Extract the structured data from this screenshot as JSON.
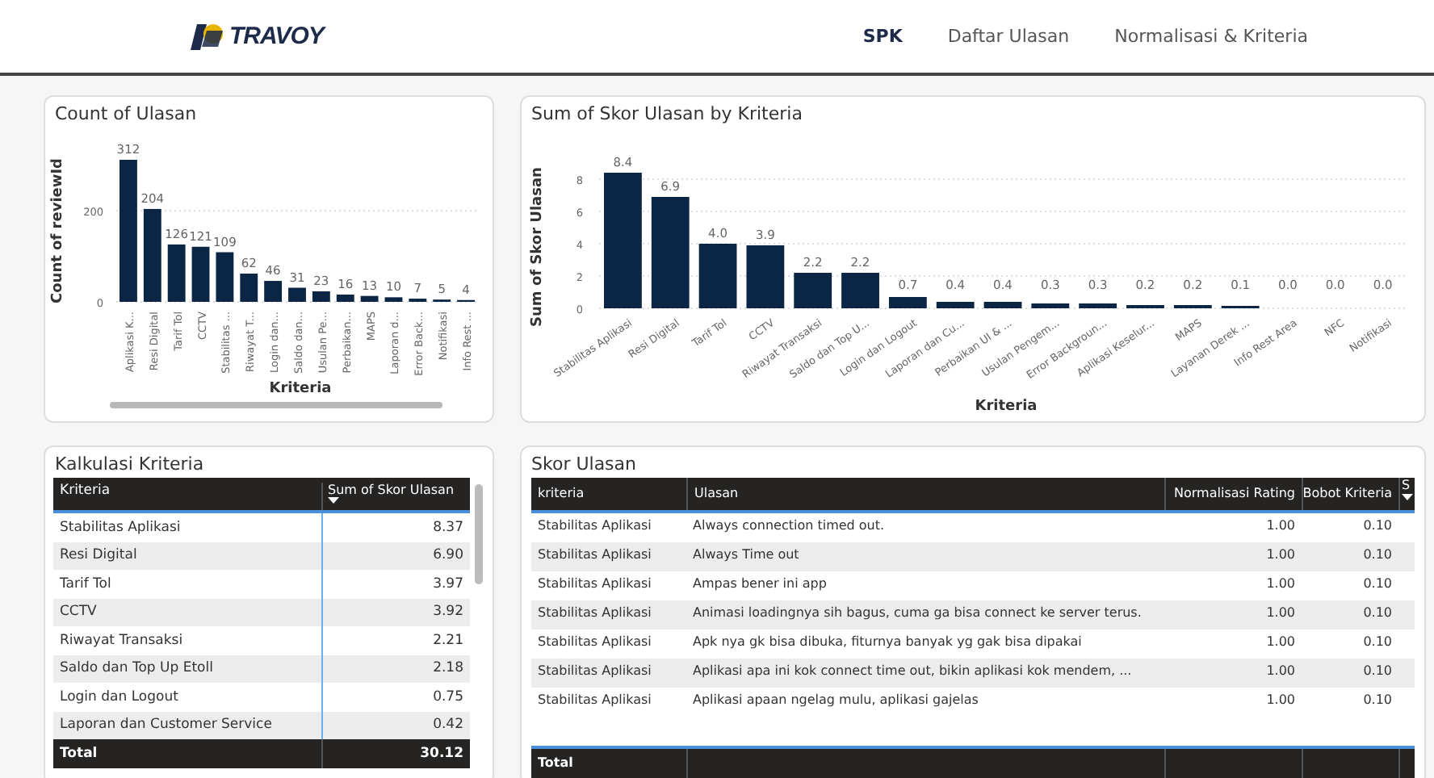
{
  "header": {
    "logo_text": "TRAVOY",
    "nav": [
      {
        "label": "SPK",
        "selected": true
      },
      {
        "label": "Daftar Ulasan",
        "selected": false
      },
      {
        "label": "Normalisasi & Kriteria",
        "selected": false
      }
    ]
  },
  "count_card": {
    "title": "Count of Ulasan",
    "chart_data": {
      "type": "bar",
      "xlabel": "Kriteria",
      "ylabel": "Count of reviewId",
      "categories": [
        "Aplikasi K...",
        "Resi Digital",
        "Tarif Tol",
        "CCTV",
        "Stabilitas ...",
        "Riwayat T...",
        "Login dan...",
        "Saldo dan...",
        "Usulan Pe...",
        "Perbaikan...",
        "MAPS",
        "Laporan d...",
        "Error Back...",
        "Notifikasi",
        "Info Rest ..."
      ],
      "values": [
        312,
        204,
        126,
        121,
        109,
        62,
        46,
        31,
        23,
        16,
        13,
        10,
        7,
        5,
        4
      ],
      "value_labels": [
        "312",
        "204",
        "126",
        "121",
        "109",
        "62",
        "46",
        "31",
        "23",
        "16",
        "13",
        "10",
        "7",
        "5",
        "4"
      ],
      "yticks": [
        0,
        200
      ],
      "ylim": [
        0,
        312
      ],
      "grid": true
    }
  },
  "sum_card": {
    "title": "Sum of Skor Ulasan by Kriteria",
    "chart_data": {
      "type": "bar",
      "xlabel": "Kriteria",
      "ylabel": "Sum of Skor Ulasan",
      "categories": [
        "Stabilitas Aplikasi",
        "Resi Digital",
        "Tarif Tol",
        "CCTV",
        "Riwayat Transaksi",
        "Saldo dan Top U...",
        "Login dan Logout",
        "Laporan dan Cu...",
        "Perbaikan UI & ...",
        "Usulan Pengem...",
        "Error Backgroun...",
        "Aplikasi Keselur...",
        "MAPS",
        "Layanan Derek ...",
        "Info Rest Area",
        "NFC",
        "Notifikasi"
      ],
      "values": [
        8.4,
        6.9,
        4.0,
        3.9,
        2.2,
        2.2,
        0.7,
        0.4,
        0.4,
        0.3,
        0.3,
        0.2,
        0.2,
        0.1,
        0.0,
        0.0,
        0.0
      ],
      "value_labels": [
        "8.4",
        "6.9",
        "4.0",
        "3.9",
        "2.2",
        "2.2",
        "0.7",
        "0.4",
        "0.4",
        "0.3",
        "0.3",
        "0.2",
        "0.2",
        "0.1",
        "0.0",
        "0.0",
        "0.0"
      ],
      "yticks": [
        0,
        2,
        4,
        6,
        8
      ],
      "ylim": [
        0,
        8.4
      ],
      "grid": true
    }
  },
  "kalkulasi": {
    "title": "Kalkulasi Kriteria",
    "columns": [
      "Kriteria",
      "Sum of Skor Ulasan"
    ],
    "rows": [
      [
        "Stabilitas Aplikasi",
        "8.37"
      ],
      [
        "Resi Digital",
        "6.90"
      ],
      [
        "Tarif Tol",
        "3.97"
      ],
      [
        "CCTV",
        "3.92"
      ],
      [
        "Riwayat Transaksi",
        "2.21"
      ],
      [
        "Saldo dan Top Up Etoll",
        "2.18"
      ],
      [
        "Login dan Logout",
        "0.75"
      ],
      [
        "Laporan dan Customer Service",
        "0.42"
      ]
    ],
    "total": [
      "Total",
      "30.12"
    ]
  },
  "skor": {
    "title": "Skor Ulasan",
    "columns": [
      "kriteria",
      "Ulasan",
      "Normalisasi Rating",
      "Bobot Kriteria",
      "S"
    ],
    "rows": [
      [
        "Stabilitas Aplikasi",
        "Always connection timed out.",
        "1.00",
        "0.10"
      ],
      [
        "Stabilitas Aplikasi",
        "Always Time out",
        "1.00",
        "0.10"
      ],
      [
        "Stabilitas Aplikasi",
        "Ampas bener ini app",
        "1.00",
        "0.10"
      ],
      [
        "Stabilitas Aplikasi",
        "Animasi loadingnya sih bagus, cuma ga bisa connect ke server terus.",
        "1.00",
        "0.10"
      ],
      [
        "Stabilitas Aplikasi",
        "Apk nya gk bisa dibuka, fiturnya banyak yg gak bisa dipakai",
        "1.00",
        "0.10"
      ],
      [
        "Stabilitas Aplikasi",
        "Aplikasi apa ini kok connect time out, bikin aplikasi kok mendem, ...",
        "1.00",
        "0.10"
      ],
      [
        "Stabilitas Aplikasi",
        "Aplikasi apaan ngelag mulu, aplikasi gajelas",
        "1.00",
        "0.10"
      ]
    ],
    "total": "Total"
  }
}
